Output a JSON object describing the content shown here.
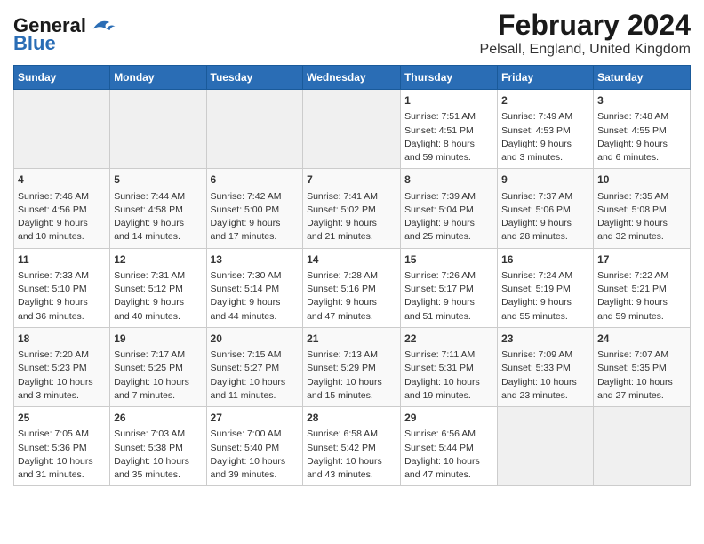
{
  "logo": {
    "line1": "General",
    "line2": "Blue"
  },
  "title": "February 2024",
  "subtitle": "Pelsall, England, United Kingdom",
  "days_of_week": [
    "Sunday",
    "Monday",
    "Tuesday",
    "Wednesday",
    "Thursday",
    "Friday",
    "Saturday"
  ],
  "weeks": [
    [
      {
        "day": "",
        "info": ""
      },
      {
        "day": "",
        "info": ""
      },
      {
        "day": "",
        "info": ""
      },
      {
        "day": "",
        "info": ""
      },
      {
        "day": "1",
        "info": "Sunrise: 7:51 AM\nSunset: 4:51 PM\nDaylight: 8 hours\nand 59 minutes."
      },
      {
        "day": "2",
        "info": "Sunrise: 7:49 AM\nSunset: 4:53 PM\nDaylight: 9 hours\nand 3 minutes."
      },
      {
        "day": "3",
        "info": "Sunrise: 7:48 AM\nSunset: 4:55 PM\nDaylight: 9 hours\nand 6 minutes."
      }
    ],
    [
      {
        "day": "4",
        "info": "Sunrise: 7:46 AM\nSunset: 4:56 PM\nDaylight: 9 hours\nand 10 minutes."
      },
      {
        "day": "5",
        "info": "Sunrise: 7:44 AM\nSunset: 4:58 PM\nDaylight: 9 hours\nand 14 minutes."
      },
      {
        "day": "6",
        "info": "Sunrise: 7:42 AM\nSunset: 5:00 PM\nDaylight: 9 hours\nand 17 minutes."
      },
      {
        "day": "7",
        "info": "Sunrise: 7:41 AM\nSunset: 5:02 PM\nDaylight: 9 hours\nand 21 minutes."
      },
      {
        "day": "8",
        "info": "Sunrise: 7:39 AM\nSunset: 5:04 PM\nDaylight: 9 hours\nand 25 minutes."
      },
      {
        "day": "9",
        "info": "Sunrise: 7:37 AM\nSunset: 5:06 PM\nDaylight: 9 hours\nand 28 minutes."
      },
      {
        "day": "10",
        "info": "Sunrise: 7:35 AM\nSunset: 5:08 PM\nDaylight: 9 hours\nand 32 minutes."
      }
    ],
    [
      {
        "day": "11",
        "info": "Sunrise: 7:33 AM\nSunset: 5:10 PM\nDaylight: 9 hours\nand 36 minutes."
      },
      {
        "day": "12",
        "info": "Sunrise: 7:31 AM\nSunset: 5:12 PM\nDaylight: 9 hours\nand 40 minutes."
      },
      {
        "day": "13",
        "info": "Sunrise: 7:30 AM\nSunset: 5:14 PM\nDaylight: 9 hours\nand 44 minutes."
      },
      {
        "day": "14",
        "info": "Sunrise: 7:28 AM\nSunset: 5:16 PM\nDaylight: 9 hours\nand 47 minutes."
      },
      {
        "day": "15",
        "info": "Sunrise: 7:26 AM\nSunset: 5:17 PM\nDaylight: 9 hours\nand 51 minutes."
      },
      {
        "day": "16",
        "info": "Sunrise: 7:24 AM\nSunset: 5:19 PM\nDaylight: 9 hours\nand 55 minutes."
      },
      {
        "day": "17",
        "info": "Sunrise: 7:22 AM\nSunset: 5:21 PM\nDaylight: 9 hours\nand 59 minutes."
      }
    ],
    [
      {
        "day": "18",
        "info": "Sunrise: 7:20 AM\nSunset: 5:23 PM\nDaylight: 10 hours\nand 3 minutes."
      },
      {
        "day": "19",
        "info": "Sunrise: 7:17 AM\nSunset: 5:25 PM\nDaylight: 10 hours\nand 7 minutes."
      },
      {
        "day": "20",
        "info": "Sunrise: 7:15 AM\nSunset: 5:27 PM\nDaylight: 10 hours\nand 11 minutes."
      },
      {
        "day": "21",
        "info": "Sunrise: 7:13 AM\nSunset: 5:29 PM\nDaylight: 10 hours\nand 15 minutes."
      },
      {
        "day": "22",
        "info": "Sunrise: 7:11 AM\nSunset: 5:31 PM\nDaylight: 10 hours\nand 19 minutes."
      },
      {
        "day": "23",
        "info": "Sunrise: 7:09 AM\nSunset: 5:33 PM\nDaylight: 10 hours\nand 23 minutes."
      },
      {
        "day": "24",
        "info": "Sunrise: 7:07 AM\nSunset: 5:35 PM\nDaylight: 10 hours\nand 27 minutes."
      }
    ],
    [
      {
        "day": "25",
        "info": "Sunrise: 7:05 AM\nSunset: 5:36 PM\nDaylight: 10 hours\nand 31 minutes."
      },
      {
        "day": "26",
        "info": "Sunrise: 7:03 AM\nSunset: 5:38 PM\nDaylight: 10 hours\nand 35 minutes."
      },
      {
        "day": "27",
        "info": "Sunrise: 7:00 AM\nSunset: 5:40 PM\nDaylight: 10 hours\nand 39 minutes."
      },
      {
        "day": "28",
        "info": "Sunrise: 6:58 AM\nSunset: 5:42 PM\nDaylight: 10 hours\nand 43 minutes."
      },
      {
        "day": "29",
        "info": "Sunrise: 6:56 AM\nSunset: 5:44 PM\nDaylight: 10 hours\nand 47 minutes."
      },
      {
        "day": "",
        "info": ""
      },
      {
        "day": "",
        "info": ""
      }
    ]
  ]
}
